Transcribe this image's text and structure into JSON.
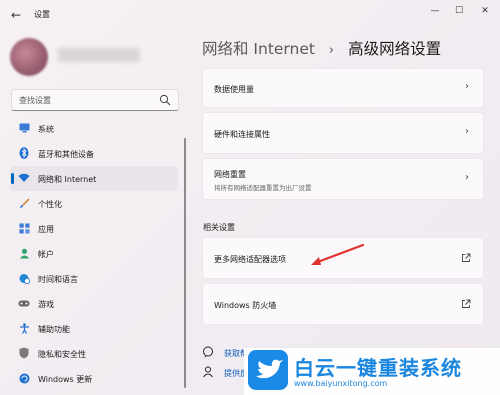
{
  "window": {
    "title": "设置",
    "back_glyph": "←",
    "minimize_glyph": "—",
    "maximize_glyph": "☐",
    "close_glyph": "✕"
  },
  "search": {
    "placeholder": "查找设置"
  },
  "sidebar": {
    "items": [
      {
        "label": "系统",
        "icon": "monitor-icon"
      },
      {
        "label": "蓝牙和其他设备",
        "icon": "bluetooth-icon"
      },
      {
        "label": "网络和 Internet",
        "icon": "wifi-icon",
        "active": true
      },
      {
        "label": "个性化",
        "icon": "brush-icon"
      },
      {
        "label": "应用",
        "icon": "apps-icon"
      },
      {
        "label": "帐户",
        "icon": "account-icon"
      },
      {
        "label": "时间和语言",
        "icon": "globe-clock-icon"
      },
      {
        "label": "游戏",
        "icon": "gamepad-icon"
      },
      {
        "label": "辅助功能",
        "icon": "accessibility-icon"
      },
      {
        "label": "隐私和安全性",
        "icon": "shield-icon"
      },
      {
        "label": "Windows 更新",
        "icon": "update-icon"
      }
    ]
  },
  "breadcrumb": {
    "parent": "网络和 Internet",
    "separator": "›",
    "current": "高级网络设置"
  },
  "cards": {
    "data_usage": {
      "title": "数据使用量",
      "chevron": "›"
    },
    "hardware": {
      "title": "硬件和连接属性",
      "chevron": "›"
    },
    "network_reset": {
      "title": "网络重置",
      "subtitle": "将所有网络适配器重置为出厂设置",
      "chevron": "›"
    }
  },
  "related": {
    "heading": "相关设置",
    "more_adapters": "更多网络适配器选项",
    "firewall": "Windows 防火墙"
  },
  "help": {
    "get_help": "获取帮助",
    "feedback": "提供反馈"
  },
  "watermark": {
    "name": "白云一键重装系统",
    "url": "www.baiyunxitong.com"
  },
  "colors": {
    "accent": "#0067c0",
    "link": "#0a5bb8",
    "annotation_arrow": "#e0322f",
    "watermark_blue": "#1a86e0"
  }
}
